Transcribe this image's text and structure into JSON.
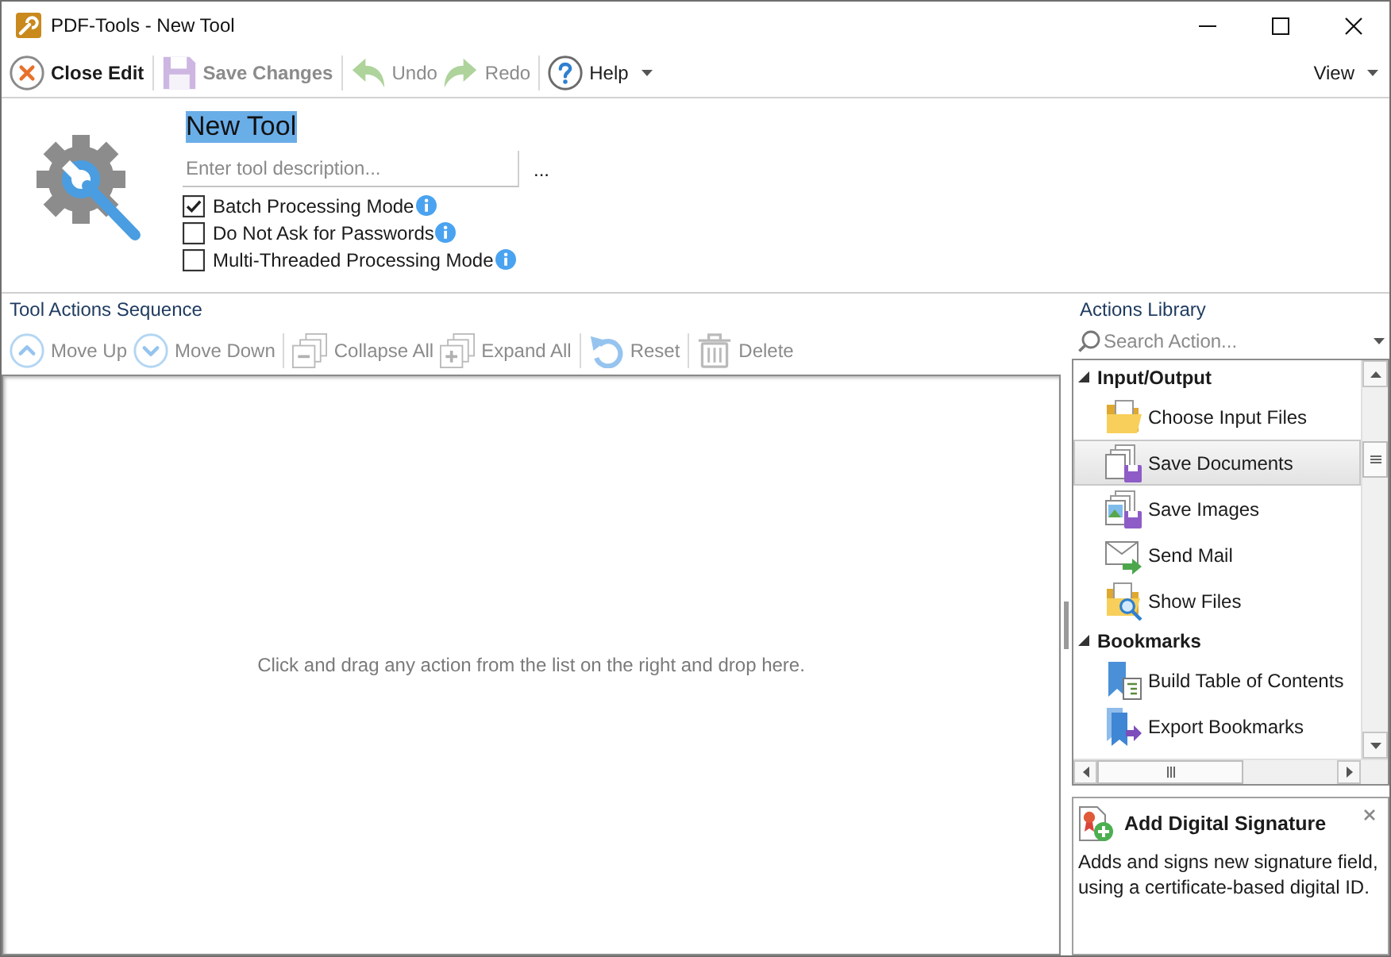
{
  "window": {
    "title": "PDF-Tools - New Tool"
  },
  "toolbar": {
    "groups": [
      {
        "buttons": [
          {
            "label": "Close Edit",
            "kind": "close-edit",
            "disabled": false
          }
        ]
      },
      {
        "buttons": [
          {
            "label": "Save Changes",
            "kind": "save",
            "disabled": true
          }
        ]
      },
      {
        "buttons": [
          {
            "label": "Undo",
            "kind": "undo",
            "disabled": true
          },
          {
            "label": "Redo",
            "kind": "redo",
            "disabled": true
          }
        ]
      },
      {
        "buttons": [
          {
            "label": "Help",
            "kind": "help",
            "disabled": false,
            "dropdown": true
          }
        ]
      }
    ],
    "view": {
      "label": "View",
      "dropdown": true
    }
  },
  "tool": {
    "name": {
      "value": "New Tool",
      "selected": true
    },
    "description": {
      "placeholder": "Enter tool description..."
    },
    "more_button": "...",
    "options": [
      {
        "label": "Batch Processing Mode",
        "checked": true
      },
      {
        "label": "Do Not Ask for Passwords",
        "checked": false
      },
      {
        "label": "Multi-Threaded Processing Mode",
        "checked": false
      }
    ]
  },
  "sequence": {
    "title": "Tool Actions Sequence",
    "toolbar": {
      "groups": [
        {
          "buttons": [
            {
              "label": "Move Up",
              "kind": "move-up",
              "disabled": true
            },
            {
              "label": "Move Down",
              "kind": "move-down",
              "disabled": true
            }
          ]
        },
        {
          "buttons": [
            {
              "label": "Collapse All",
              "kind": "collapse-all",
              "disabled": true
            },
            {
              "label": "Expand All",
              "kind": "expand-all",
              "disabled": true
            }
          ]
        },
        {
          "buttons": [
            {
              "label": "Reset",
              "kind": "reset",
              "disabled": true
            }
          ]
        },
        {
          "buttons": [
            {
              "label": "Delete",
              "kind": "delete",
              "disabled": true
            }
          ]
        }
      ]
    },
    "empty_hint": "Click and drag any action from the list on the right and drop here."
  },
  "library": {
    "title": "Actions Library",
    "search": {
      "placeholder": "Search Action..."
    },
    "groups": [
      {
        "label": "Input/Output",
        "expanded": true,
        "children": [
          {
            "label": "Choose Input Files",
            "kind": "open-folder",
            "selected": false
          },
          {
            "label": "Save Documents",
            "kind": "save-documents",
            "selected": true
          },
          {
            "label": "Save Images",
            "kind": "save-images",
            "selected": false
          },
          {
            "label": "Send Mail",
            "kind": "send-mail",
            "selected": false
          },
          {
            "label": "Show Files",
            "kind": "show-files",
            "selected": false
          }
        ]
      },
      {
        "label": "Bookmarks",
        "expanded": true,
        "children": [
          {
            "label": "Build Table of Contents",
            "kind": "build-toc",
            "selected": false
          },
          {
            "label": "Export Bookmarks",
            "kind": "export-bookmarks",
            "selected": false
          }
        ]
      }
    ]
  },
  "details": {
    "title": "Add Digital Signature",
    "text": "Adds and signs new signature field, using a certificate-based digital ID."
  }
}
